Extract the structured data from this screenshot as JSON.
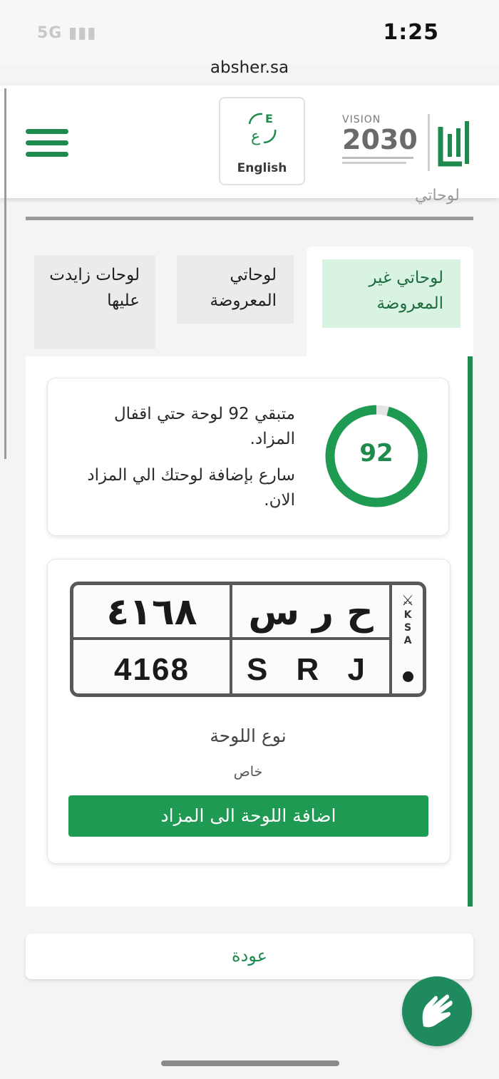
{
  "status_bar": {
    "time": "1:25",
    "network": "5G"
  },
  "browser": {
    "url": "absher.sa"
  },
  "header": {
    "language_label": "English",
    "vision_label": "VISION",
    "vision_year": "2030"
  },
  "page": {
    "partial_heading": "لوحاتي"
  },
  "tabs": [
    {
      "label": "لوحاتي غير المعروضة",
      "active": true
    },
    {
      "label": "لوحاتي المعروضة",
      "active": false
    },
    {
      "label": "لوحات زايدت عليها",
      "active": false
    }
  ],
  "countdown": {
    "value": "92",
    "progress_fraction": 0.96,
    "message_remaining": "متبقي 92 لوحة حتي اقفال المزاد.",
    "message_hurry": "سارع بإضافة لوحتك الي المزاد الان."
  },
  "plate": {
    "arabic_number": "٤١٦٨",
    "arabic_letters": "ح ر س",
    "english_number": "4168",
    "english_letters": "S R J",
    "country_code": "KSA",
    "type_label": "نوع اللوحة",
    "type_value": "خاص"
  },
  "actions": {
    "add_to_auction": "اضافة اللوحة الى المزاد",
    "back": "عودة"
  },
  "colors": {
    "brand_green": "#1e8a4d",
    "button_green": "#1e9a52",
    "active_tab_bg": "#d8f3e1"
  }
}
